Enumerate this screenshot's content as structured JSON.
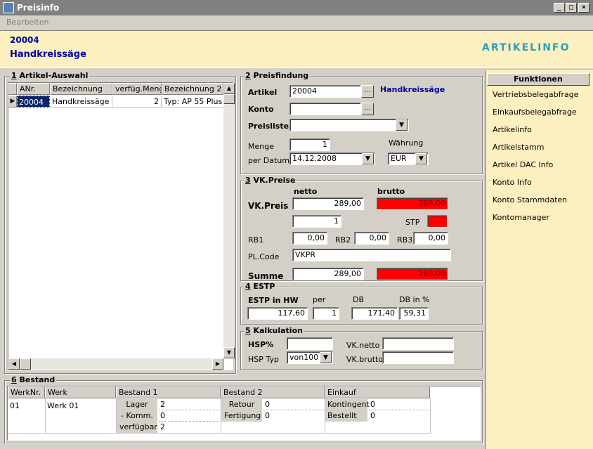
{
  "window": {
    "title": "Preisinfo",
    "min": "_",
    "max": "□",
    "close": "×"
  },
  "menu": {
    "edit": "Bearbeiten"
  },
  "header": {
    "article_no": "20004",
    "article_name": "Handkreissäge",
    "logo": "ARTIKELINFO"
  },
  "g1": {
    "num": "1",
    "title": " Artikel-Auswahl",
    "cols": [
      "ANr.",
      "Bezeichnung",
      "verfüg.Menge",
      "Bezeichnung 2"
    ],
    "row": {
      "anr": "20004",
      "bez": "Handkreissäge",
      "menge": "2",
      "bez2": "Typ: AP 55 Plus"
    }
  },
  "g2": {
    "num": "2",
    "title": " Preisfindung",
    "artikel_label": "Artikel",
    "artikel_value": "20004",
    "artikel_name": "Handkreissäge",
    "konto_label": "Konto",
    "konto_value": "",
    "preisliste_label": "Preisliste",
    "preisliste_value": "",
    "menge_label": "Menge",
    "menge_value": "1",
    "waehrung_label": "Währung",
    "datum_label": "per Datum",
    "datum_value": "14.12.2008",
    "waehrung_value": "EUR",
    "ellipsis": "..."
  },
  "g3": {
    "num": "3",
    "title": " VK.Preise",
    "netto": "netto",
    "brutto": "brutto",
    "vkpreis_label": "VK.Preis",
    "vk_netto": "289,00",
    "vk_brutto": "289,00",
    "qty": "1",
    "stp_label": "STP",
    "rb1_label": "RB1",
    "rb1": "0,00",
    "rb2_label": "RB2",
    "rb2": "0,00",
    "rb3_label": "RB3",
    "rb3": "0,00",
    "plcode_label": "PL.Code",
    "plcode": "VKPR",
    "summe_label": "Summe",
    "summe_netto": "289,00",
    "summe_brutto": "289,00"
  },
  "g4": {
    "num": "4",
    "title": " ESTP",
    "estp_label": "ESTP in HW",
    "per_label": "per",
    "db_label": "DB",
    "dbp_label": "DB in %",
    "estp": "117,60",
    "per": "1",
    "db": "171,40",
    "dbp": "59,31"
  },
  "g5": {
    "num": "5",
    "title": " Kalkulation",
    "hsp_label": "HSP%",
    "hsp": "",
    "hsptyp_label": "HSP Typ",
    "hsptyp": "von100",
    "vknetto_label": "VK.netto",
    "vknetto": "",
    "vkbrutto_label": "VK.brutto",
    "vkbrutto": ""
  },
  "g6": {
    "num": "6",
    "title": " Bestand",
    "cols": [
      "WerkNr.",
      "Werk",
      "Bestand 1",
      "Bestand 2",
      "Einkauf"
    ],
    "werknr": "01",
    "werk": "Werk 01",
    "lager_label": "Lager",
    "lager": "2",
    "komm_label": "- Komm.",
    "komm": "0",
    "verf_label": "verfügbar",
    "verf": "2",
    "retour_label": "Retour",
    "retour": "0",
    "fert_label": "Fertigung",
    "fert": "0",
    "kont_label": "Kontingent",
    "kont": "0",
    "best_label": "Bestellt",
    "best": "0"
  },
  "side": {
    "title": "Funktionen",
    "items": [
      "Vertriebsbelegabfrage",
      "Einkaufsbelegabfrage",
      "Artikelinfo",
      "Artikelstamm",
      "Artikel DAC Info",
      "Konto Info",
      "Konto Stammdaten",
      "Kontomanager"
    ]
  },
  "icons": {
    "dropdown": "chevron-down-icon",
    "scroll_up": "arrow-up-icon",
    "scroll_down": "arrow-down-icon",
    "scroll_left": "arrow-left-icon",
    "scroll_right": "arrow-right-icon"
  }
}
